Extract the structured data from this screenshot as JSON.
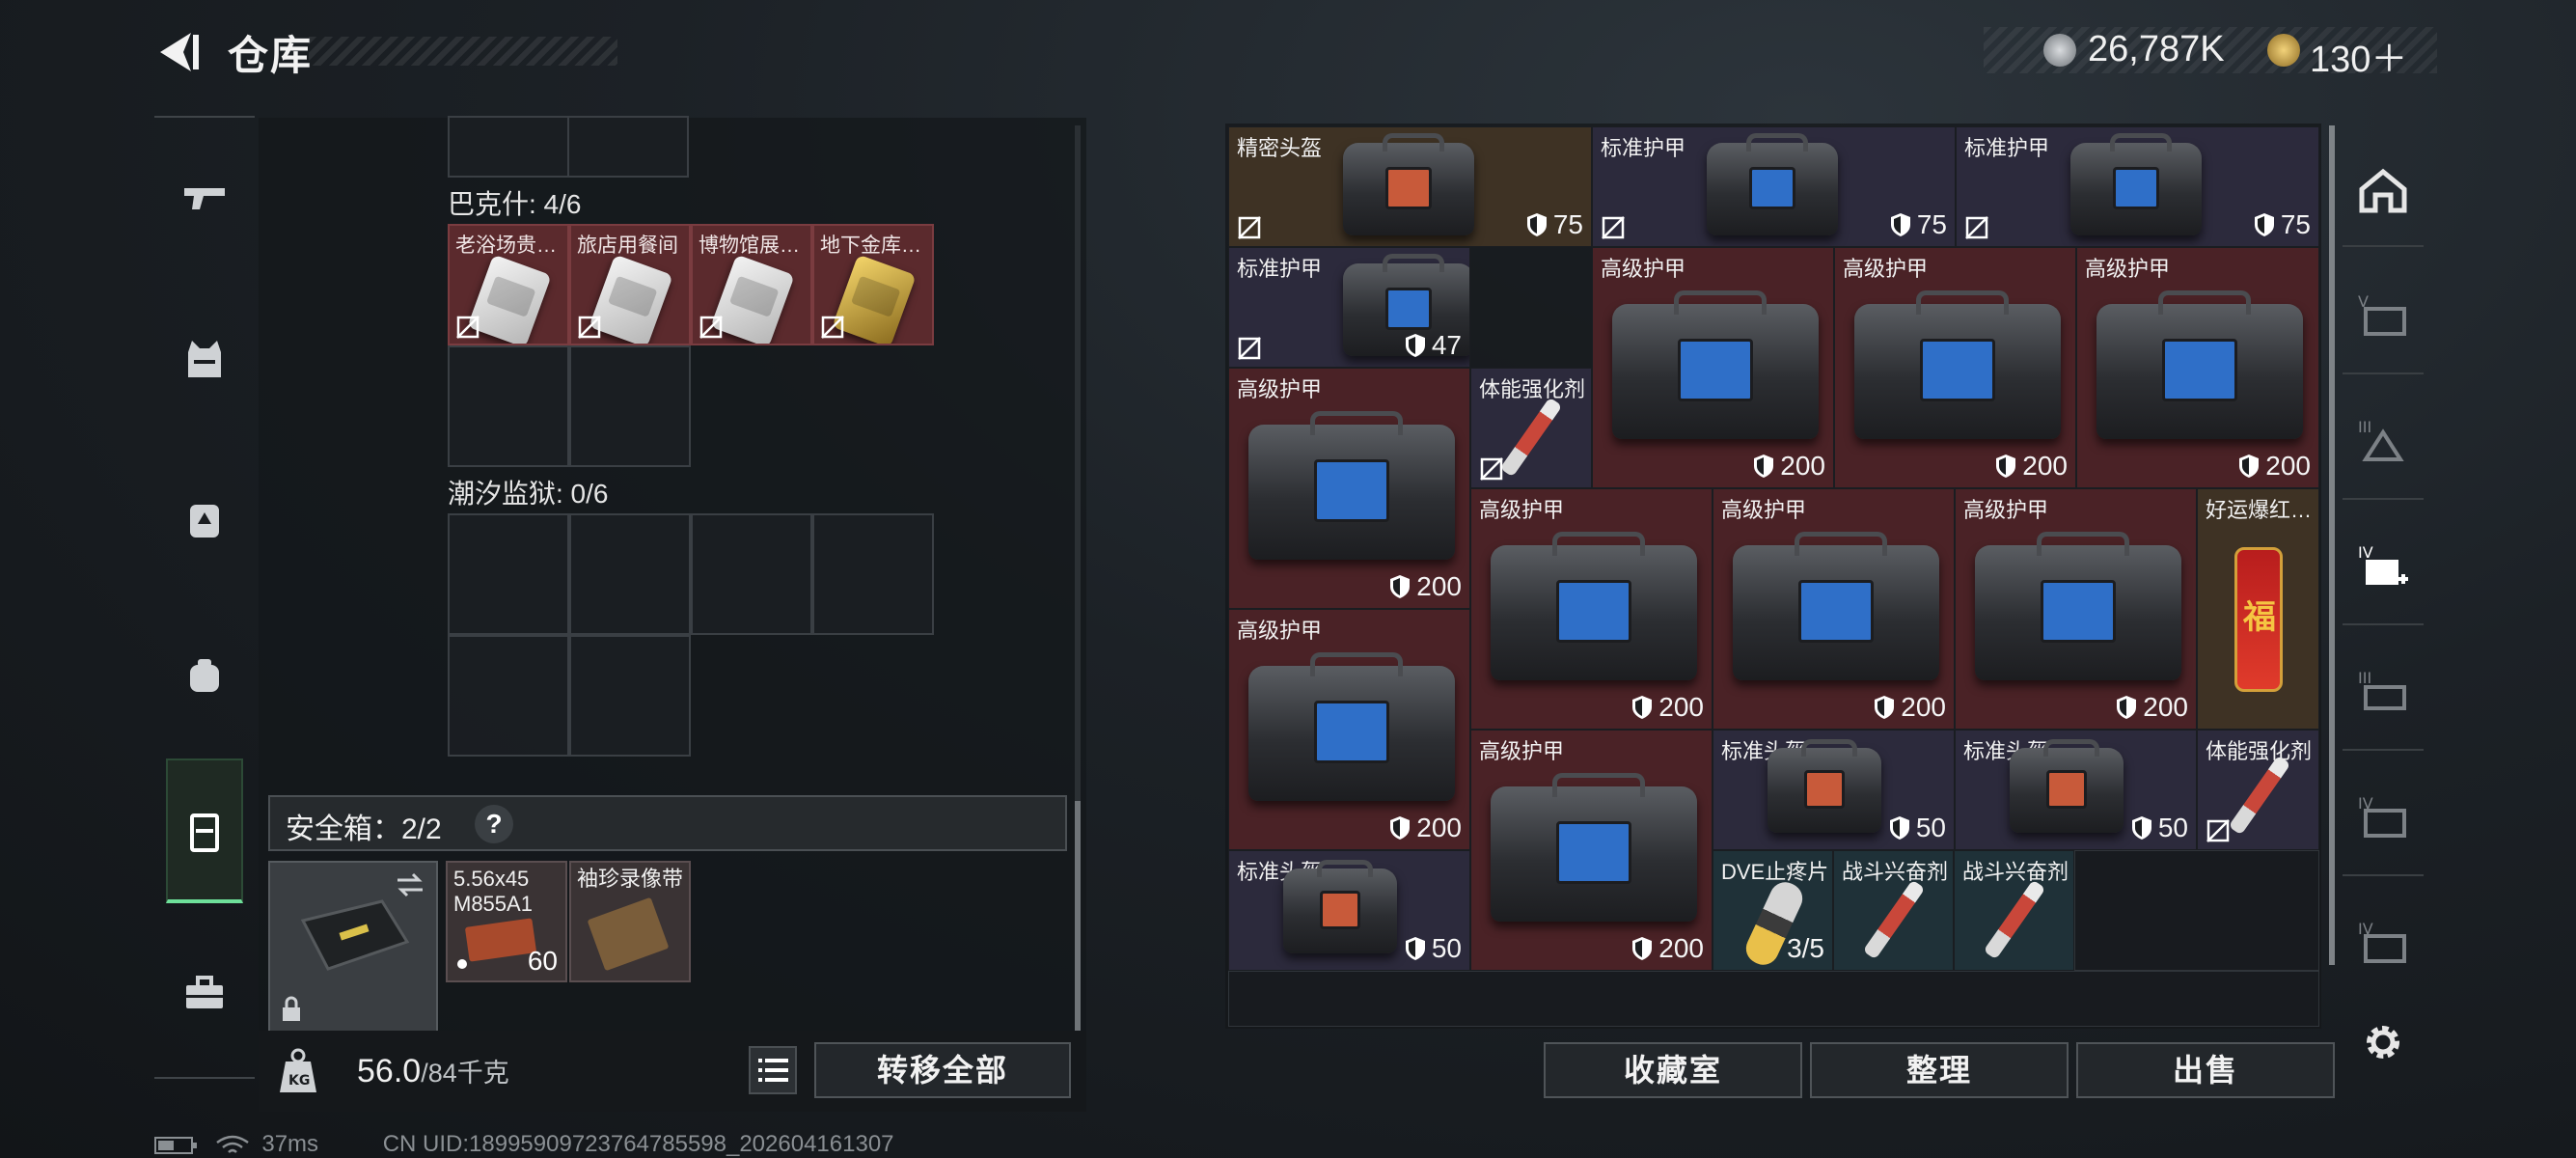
{
  "header": {
    "title": "仓库",
    "currency1": "26,787K",
    "currency2": "130＋"
  },
  "left": {
    "section1": {
      "label": "巴克什: 4/6",
      "keys": [
        "老浴场贵…",
        "旅店用餐间",
        "博物馆展…",
        "地下金库…"
      ]
    },
    "section2": {
      "label": "潮汐监狱: 0/6"
    },
    "safebox": {
      "label": "安全箱：2/2",
      "help": "?",
      "ammo_label": "5.56x45 M855A1",
      "ammo_count": "60",
      "tape_label": "袖珍录像带"
    },
    "weight": {
      "current": "56.0",
      "max": "/84千克"
    },
    "transfer_all": "转移全部"
  },
  "warehouse": {
    "items": [
      {
        "label": "精密头盔",
        "value": "75"
      },
      {
        "label": "标准护甲",
        "value": "75"
      },
      {
        "label": "标准护甲",
        "value": "75"
      },
      {
        "label": "标准护甲",
        "value": "47"
      },
      {
        "label": "高级护甲",
        "value": "200"
      },
      {
        "label": "高级护甲",
        "value": "200"
      },
      {
        "label": "高级护甲",
        "value": "200"
      },
      {
        "label": "高级护甲",
        "value": "200"
      },
      {
        "label": "体能强化剂",
        "value": ""
      },
      {
        "label": "高级护甲",
        "value": "200"
      },
      {
        "label": "高级护甲",
        "value": "200"
      },
      {
        "label": "高级护甲",
        "value": "200"
      },
      {
        "label": "好运爆红…",
        "value": ""
      },
      {
        "label": "高级护甲",
        "value": "200"
      },
      {
        "label": "高级护甲",
        "value": "200"
      },
      {
        "label": "标准头盔",
        "value": "50"
      },
      {
        "label": "标准头盔",
        "value": "50"
      },
      {
        "label": "体能强化剂",
        "value": ""
      },
      {
        "label": "标准头盔",
        "value": "50"
      },
      {
        "label": "DVE止疼片",
        "value": "3/5"
      },
      {
        "label": "战斗兴奋剂",
        "value": ""
      },
      {
        "label": "战斗兴奋剂",
        "value": ""
      }
    ],
    "buttons": {
      "collection": "收藏室",
      "sort": "整理",
      "sell": "出售"
    }
  },
  "status": {
    "ping": "37ms",
    "uid": "CN UID:18995909723764785598_202604161307"
  },
  "colors": {
    "accent": "#6ee09a",
    "armor_bg": "#4a2226",
    "standard_bg": "#2c2a3c"
  }
}
